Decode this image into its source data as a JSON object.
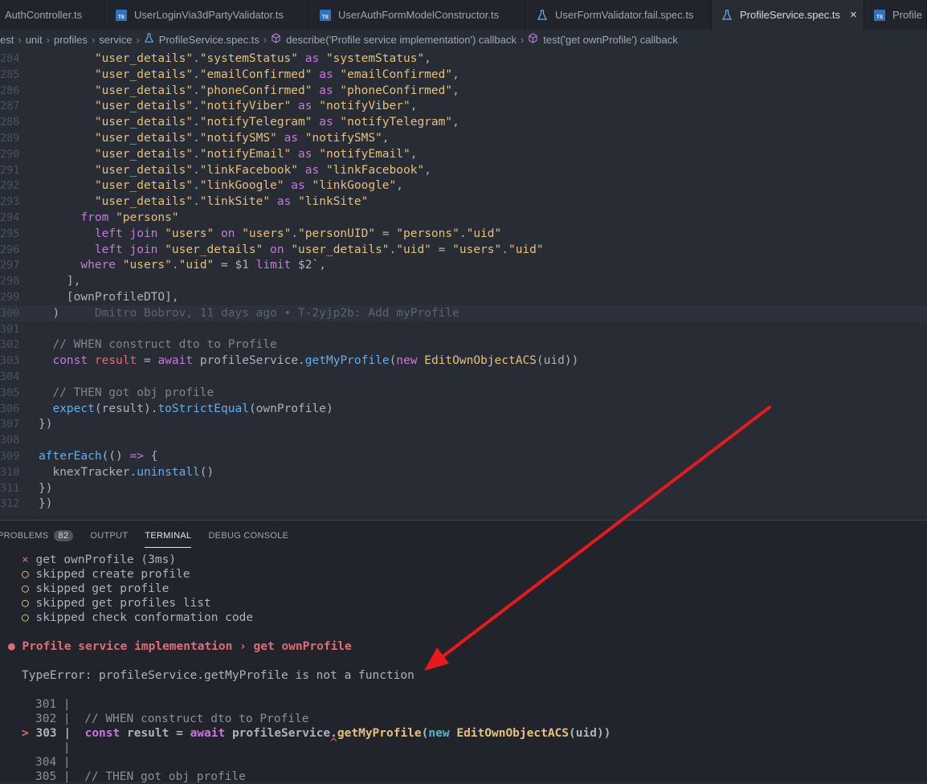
{
  "tabs": [
    {
      "label": "AuthController.ts",
      "icon": "typescript-file-icon"
    },
    {
      "label": "UserLoginVia3dPartyValidator.ts",
      "icon": "typescript-file-icon"
    },
    {
      "label": "UserAuthFormModelConstructor.ts",
      "icon": "typescript-file-icon"
    },
    {
      "label": "UserFormValidator.fail.spec.ts",
      "icon": "test-flask-icon"
    },
    {
      "label": "ProfileService.spec.ts",
      "icon": "test-flask-icon",
      "active": true
    },
    {
      "label": "Profile",
      "icon": "typescript-file-icon"
    }
  ],
  "breadcrumb": [
    "est",
    "unit",
    "profiles",
    "service",
    "ProfileService.spec.ts",
    "describe('Profile service implementation') callback",
    "test('get ownProfile') callback"
  ],
  "code": {
    "blame": "Dmitro Bobrov, 11 days ago • T-2yjp2b: Add myProfile",
    "lines": [
      {
        "n": "284",
        "t": "        \"user_details\".\"systemStatus\" as \"systemStatus\","
      },
      {
        "n": "285",
        "t": "        \"user_details\".\"emailConfirmed\" as \"emailConfirmed\","
      },
      {
        "n": "286",
        "t": "        \"user_details\".\"phoneConfirmed\" as \"phoneConfirmed\","
      },
      {
        "n": "287",
        "t": "        \"user_details\".\"notifyViber\" as \"notifyViber\","
      },
      {
        "n": "288",
        "t": "        \"user_details\".\"notifyTelegram\" as \"notifyTelegram\","
      },
      {
        "n": "289",
        "t": "        \"user_details\".\"notifySMS\" as \"notifySMS\","
      },
      {
        "n": "290",
        "t": "        \"user_details\".\"notifyEmail\" as \"notifyEmail\","
      },
      {
        "n": "291",
        "t": "        \"user_details\".\"linkFacebook\" as \"linkFacebook\","
      },
      {
        "n": "292",
        "t": "        \"user_details\".\"linkGoogle\" as \"linkGoogle\","
      },
      {
        "n": "293",
        "t": "        \"user_details\".\"linkSite\" as \"linkSite\""
      },
      {
        "n": "294",
        "t": "      from \"persons\""
      },
      {
        "n": "295",
        "t": "        left join \"users\" on \"users\".\"personUID\" = \"persons\".\"uid\""
      },
      {
        "n": "296",
        "t": "        left join \"user_details\" on \"user_details\".\"uid\" = \"users\".\"uid\""
      },
      {
        "n": "297",
        "t": "      where \"users\".\"uid\" = $1 limit $2`,"
      },
      {
        "n": "298",
        "t": "    ],"
      },
      {
        "n": "299",
        "t": "    [ownProfileDTO],"
      },
      {
        "n": "300",
        "t": "  )"
      },
      {
        "n": "301",
        "t": ""
      },
      {
        "n": "302",
        "t": "  // WHEN construct dto to Profile"
      },
      {
        "n": "303",
        "t": "  const result = await profileService.getMyProfile(new EditOwnObjectACS(uid))"
      },
      {
        "n": "304",
        "t": ""
      },
      {
        "n": "305",
        "t": "  // THEN got obj profile"
      },
      {
        "n": "306",
        "t": "  expect(result).toStrictEqual(ownProfile)"
      },
      {
        "n": "307",
        "t": "})"
      },
      {
        "n": "308",
        "t": ""
      },
      {
        "n": "309",
        "t": "afterEach(() => {"
      },
      {
        "n": "310",
        "t": "  knexTracker.uninstall()"
      },
      {
        "n": "311",
        "t": "})"
      },
      {
        "n": "312",
        "t": "})"
      }
    ]
  },
  "panel": {
    "tabs": [
      {
        "label": "PROBLEMS",
        "badge": "82"
      },
      {
        "label": "OUTPUT"
      },
      {
        "label": "TERMINAL",
        "active": true
      },
      {
        "label": "DEBUG CONSOLE"
      }
    ]
  },
  "terminal": {
    "fail_mark": "×",
    "fail_line": "get ownProfile (3ms)",
    "skip_mark": "○",
    "skipped": [
      "skipped create profile",
      "skipped get profile",
      "skipped get profiles list",
      "skipped check conformation code"
    ],
    "error_bullet": "●",
    "error_title": "Profile service implementation › get ownProfile",
    "error_message": "TypeError: profileService.getMyProfile is not a function",
    "snippet": [
      {
        "n": "301",
        "text": ""
      },
      {
        "n": "302",
        "text": "  // WHEN construct dto to Profile"
      },
      {
        "n": "303",
        "text": "  const result = await profileService.getMyProfile(new EditOwnObjectACS(uid))",
        "pointer": ">"
      },
      {
        "n": "",
        "text": ""
      },
      {
        "n": "304",
        "text": ""
      },
      {
        "n": "305",
        "text": "  // THEN got obj profile"
      }
    ],
    "caret": "^"
  },
  "annotation": {
    "color": "#e8191c"
  }
}
